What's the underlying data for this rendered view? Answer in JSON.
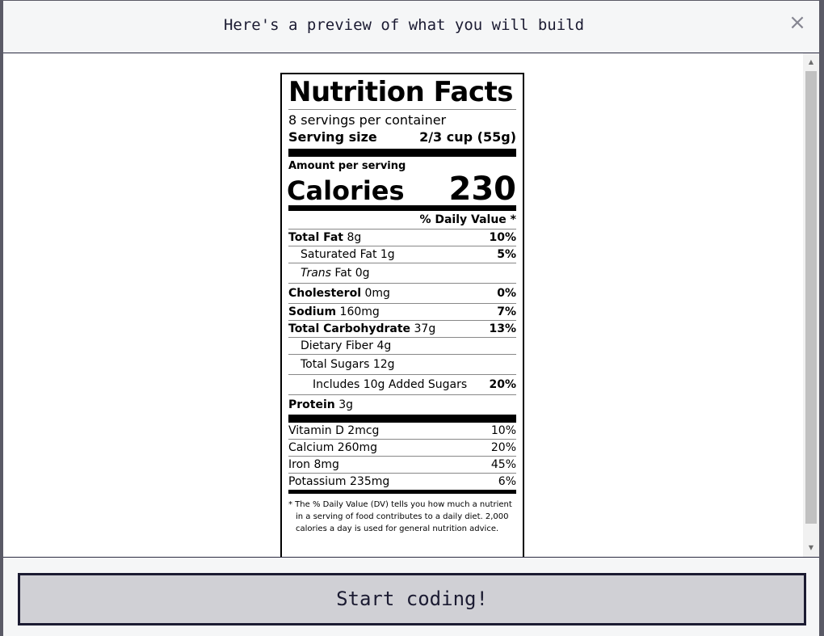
{
  "modal": {
    "title": "Here's a preview of what you will build",
    "close_glyph": "×"
  },
  "label": {
    "title": "Nutrition Facts",
    "servings": "8 servings per container",
    "serving_size_label": "Serving size",
    "serving_size_value": "2/3 cup (55g)",
    "amount_per_serving": "Amount per serving",
    "calories_label": "Calories",
    "calories_value": "230",
    "dv_header": "% Daily Value *",
    "nutrients": {
      "total_fat": {
        "name": "Total Fat",
        "amount": "8g",
        "dv": "10%"
      },
      "saturated_fat": {
        "name": "Saturated Fat 1g",
        "dv": "5%"
      },
      "trans_fat": {
        "italic": "Trans",
        "rest": "Fat 0g"
      },
      "cholesterol": {
        "name": "Cholesterol",
        "amount": "0mg",
        "dv": "0%"
      },
      "sodium": {
        "name": "Sodium",
        "amount": "160mg",
        "dv": "7%"
      },
      "total_carb": {
        "name": "Total Carbohydrate",
        "amount": "37g",
        "dv": "13%"
      },
      "dietary_fiber": {
        "name": "Dietary Fiber 4g"
      },
      "total_sugars": {
        "name": "Total Sugars 12g"
      },
      "added_sugars": {
        "name": "Includes 10g Added Sugars",
        "dv": "20%"
      },
      "protein": {
        "name": "Protein",
        "amount": "3g"
      }
    },
    "vitamins": [
      {
        "name": "Vitamin D 2mcg",
        "dv": "10%"
      },
      {
        "name": "Calcium 260mg",
        "dv": "20%"
      },
      {
        "name": "Iron 8mg",
        "dv": "45%"
      },
      {
        "name": "Potassium 235mg",
        "dv": "6%"
      }
    ],
    "footnote": "* The % Daily Value (DV) tells you how much a nutrient in a serving of food contributes to a daily diet. 2,000 calories a day is used for general nutrition advice."
  },
  "footer": {
    "start_button": "Start coding!"
  }
}
